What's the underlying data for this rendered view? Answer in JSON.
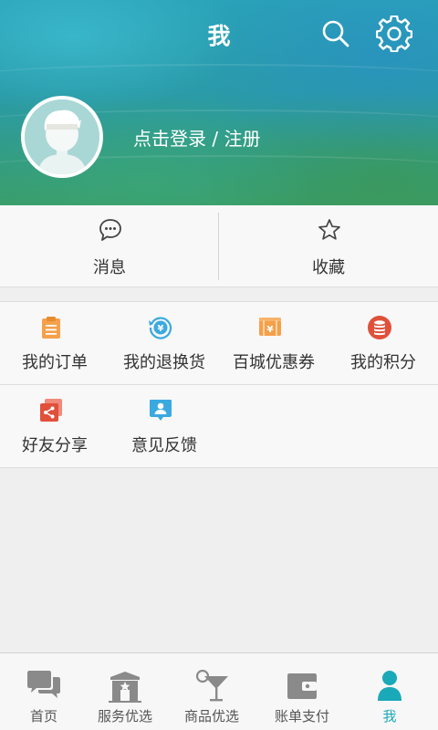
{
  "header": {
    "title": "我",
    "login_text": "点击登录 / 注册",
    "search_icon": "search-icon",
    "settings_icon": "gear-icon"
  },
  "quick_actions": [
    {
      "label": "消息",
      "icon": "chat-bubble-icon"
    },
    {
      "label": "收藏",
      "icon": "star-icon"
    }
  ],
  "grid": [
    {
      "label": "我的订单",
      "icon": "clipboard-icon",
      "color": "#f5a04a"
    },
    {
      "label": "我的退换货",
      "icon": "refund-icon",
      "color": "#3aa9e0"
    },
    {
      "label": "百城优惠券",
      "icon": "coupon-icon",
      "color": "#f5a04a"
    },
    {
      "label": "我的积分",
      "icon": "coins-icon",
      "color": "#e0503a"
    },
    {
      "label": "好友分享",
      "icon": "share-icon",
      "color": "#e0503a"
    },
    {
      "label": "意见反馈",
      "icon": "feedback-icon",
      "color": "#3aa9e0"
    }
  ],
  "bottom_nav": [
    {
      "label": "首页",
      "icon": "chat-icon",
      "active": false
    },
    {
      "label": "服务优选",
      "icon": "store-icon",
      "active": false
    },
    {
      "label": "商品优选",
      "icon": "cocktail-icon",
      "active": false
    },
    {
      "label": "账单支付",
      "icon": "wallet-icon",
      "active": false
    },
    {
      "label": "我",
      "icon": "person-icon",
      "active": true
    }
  ],
  "colors": {
    "accent": "#1aa9b9",
    "nav_inactive": "#8a8a8a",
    "background": "#efefef"
  }
}
